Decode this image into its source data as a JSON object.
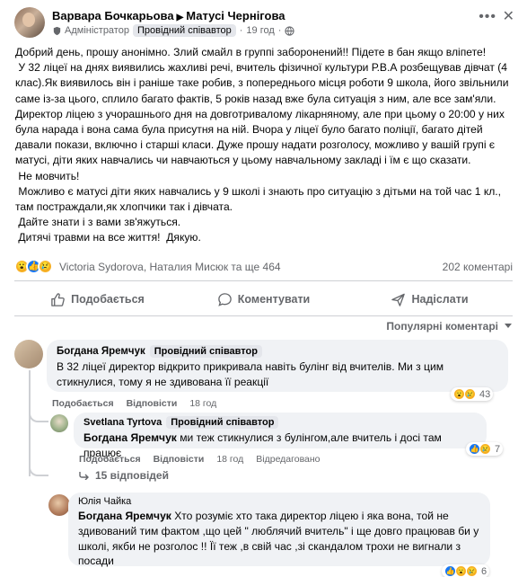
{
  "post": {
    "author": "Варвара Бочкарьова",
    "arrow": "▶",
    "group": "Матусі Чернігова",
    "admin_label": "Адміністратор",
    "badge": "Провідний співавтор",
    "separator": "·",
    "time": "19 год",
    "privacy_icon": "globe-icon",
    "body": "Добрий день, прошу анонімно. Злий смайл в группі заборонений!! Підете в бан якщо вліпете!\n У 32 ліцеї на днях виявились жахливі речі, вчитель фізичної культури Р.В.А розбещував дівчат (4 клас).Як виявилось він і раніше таке робив, з попереднього місця роботи 9 школа, його звільнили саме із-за цього, сплило багато фактів, 5 років назад вже була ситуація з ним, але все зам'яли. Директор ліцею з учорашнього дня на довготривалому лікарняному, але при цьому о 20:00 у них була нарада і вона сама була присутня на ній. Вчора у ліцеї було багато поліції, багато дітей давали покази, включно і старші класи. Дуже прошу надати розголосу, можливо у вашій групі є матусі, діти яких навчались чи навчаються у цьому навчальному закладі і їм є що сказати.\n Не мовчить!\n Можливо є матусі діти яких навчались у 9 школі і знають про ситуацію з дітьми на той час 1 кл., там постраждали,як хлопчики так і дівчата.\n Дайте знати і з вами зв'яжуться.\n Дитячі травми на все життя!  Дякую.",
    "reaction_names": "Victoria Sydorova, Наталия Мисюк та ще 464",
    "comment_count": "202 коментарі"
  },
  "actions": {
    "like": "Подобається",
    "comment": "Коментувати",
    "share": "Надіслати"
  },
  "sort_label": "Популярні коментарі",
  "comments": [
    {
      "name": "Богдана Яремчук",
      "badge": "Провідний співавтор",
      "text": "В 32 ліцеї директор відкрито прикривала навіть булінг від вчителів. Ми з цим стикнулися, тому я не здивована її реакції",
      "like": "Подобається",
      "reply": "Відповісти",
      "time": "18 год",
      "reaction_count": "43"
    },
    {
      "name": "Svetlana Tyrtova",
      "badge": "Провідний співавтор",
      "mention": "Богдана Яремчук",
      "text": " ми теж стикнулися з булінгом,але вчитель і досі там працює",
      "like": "Подобається",
      "reply": "Відповісти",
      "time": "18 год",
      "edited": "Відредаговано",
      "reaction_count": "7"
    },
    {
      "name": "Юлія Чайка",
      "mention": "Богдана Яремчук",
      "text": " Хто розуміє хто така директор ліцею і яка вона, той не здивований тим фактом ,що цей \" люблячий вчитель\" і ще довго працював би у школі, якби не розголос !! Її теж ,в свій час ,зі скандалом трохи не вигнали з посади",
      "reaction_count": "6"
    }
  ],
  "replies_link": "15 відповідей"
}
